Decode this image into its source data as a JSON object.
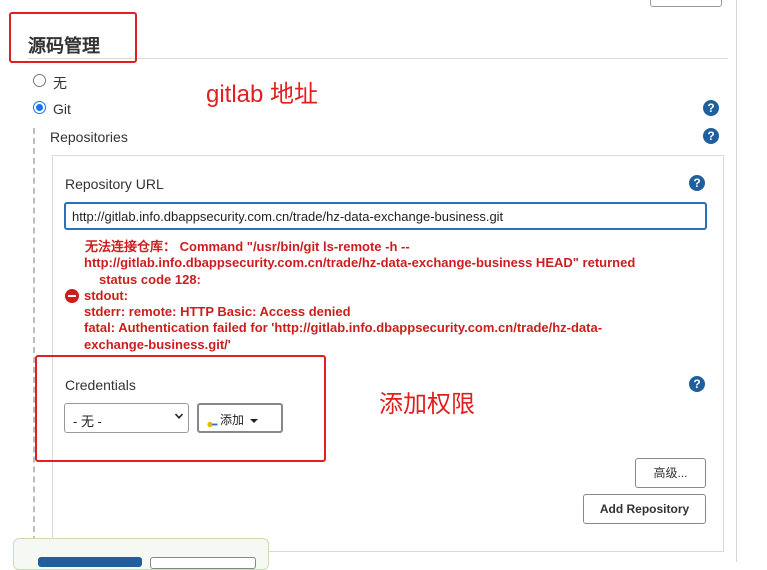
{
  "section": {
    "title": "源码管理"
  },
  "scm_options": [
    {
      "label": "无",
      "selected": false
    },
    {
      "label": "Git",
      "selected": true
    }
  ],
  "annotations": {
    "gitlab": "gitlab 地址",
    "credentials": "添加权限"
  },
  "repositories": {
    "label": "Repositories",
    "url_label": "Repository URL",
    "url_value": "http://gitlab.info.dbappsecurity.com.cn/trade/hz-data-exchange-business.git",
    "error_lines": [
      "无法连接仓库：  Command \"/usr/bin/git ls-remote -h --",
      "http://gitlab.info.dbappsecurity.com.cn/trade/hz-data-exchange-business HEAD\" returned",
      "status code 128:",
      "stdout:",
      "stderr: remote: HTTP Basic: Access denied",
      "fatal: Authentication failed for 'http://gitlab.info.dbappsecurity.com.cn/trade/hz-data-",
      "exchange-business.git/'"
    ],
    "credentials_label": "Credentials",
    "credentials_selected": "- 无 -",
    "add_button": "添加",
    "advanced_button": "高级...",
    "add_repository_button": "Add Repository"
  },
  "help_glyph": "?",
  "icons": [
    "help-icon",
    "error-icon",
    "key-icon",
    "caret-down-icon"
  ],
  "colors": {
    "annotation": "#e02020",
    "error": "#cc1e1e",
    "help": "#1f5f9e",
    "focus": "#2c6fbf"
  }
}
